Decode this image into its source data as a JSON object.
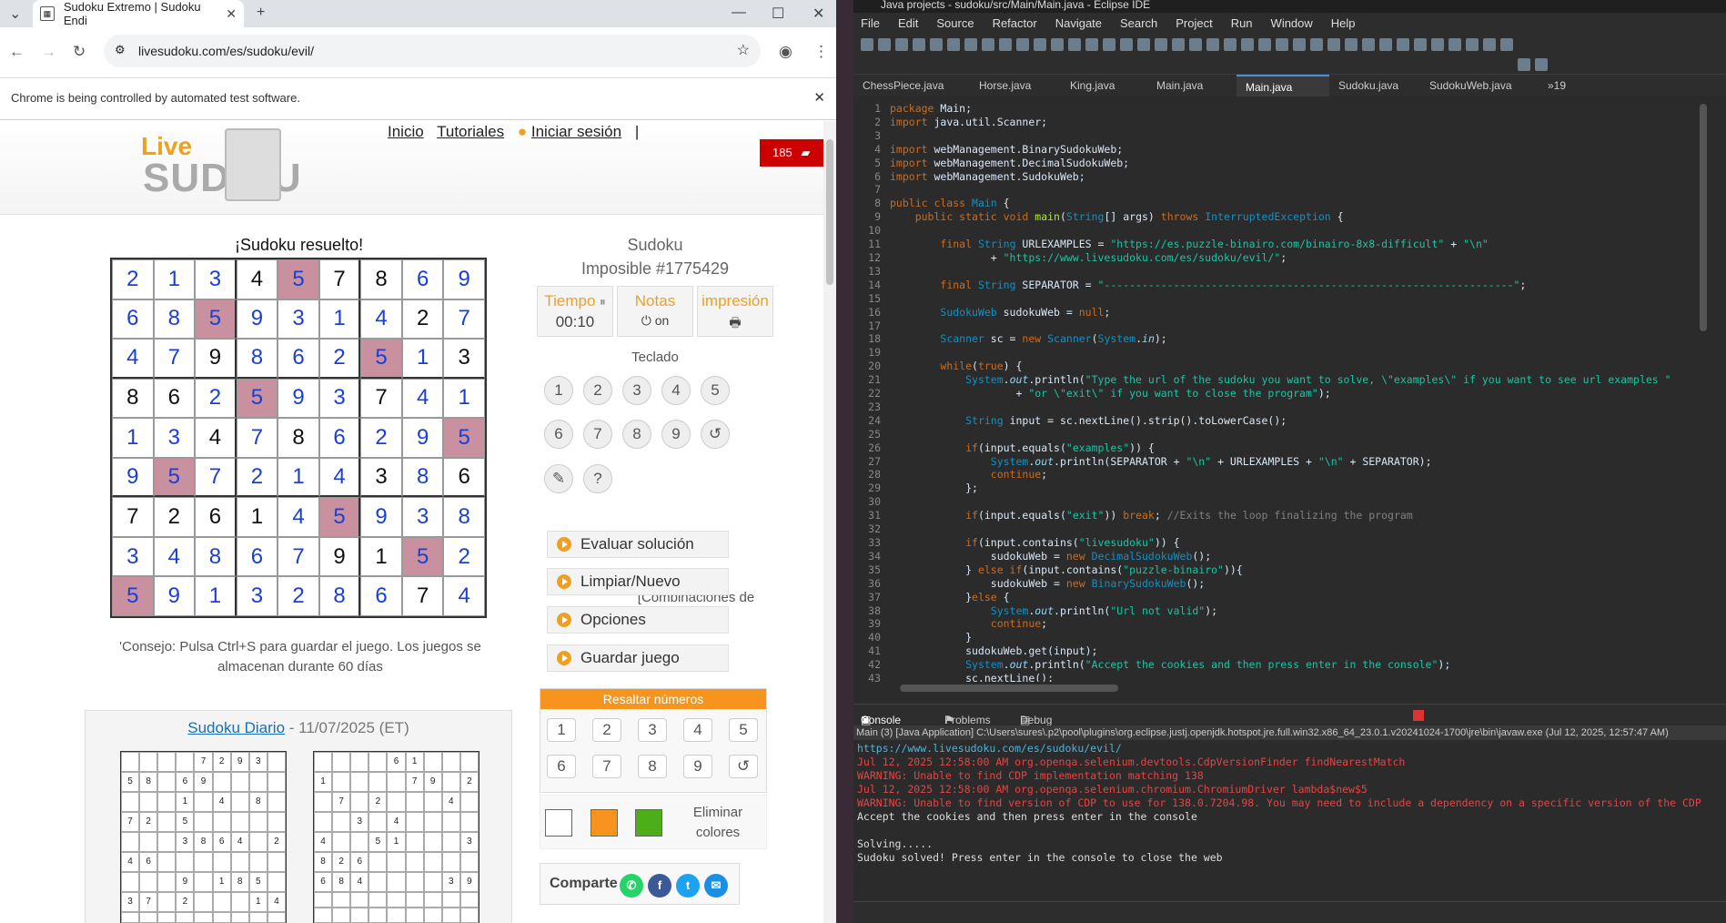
{
  "browser": {
    "tab_title": "Sudoku Extremo | Sudoku Endi",
    "url": "livesudoku.com/es/sudoku/evil/",
    "infobar": "Chrome is being controlled by automated test software."
  },
  "site": {
    "logo_top": "Live",
    "logo_bottom": "SUD  KU",
    "nav": [
      "Inicio",
      "Tutoriales",
      "Iniciar sesión"
    ],
    "message_count": "185",
    "solved_title": "¡Sudoku resuelto!",
    "puzzle_type": "Sudoku",
    "puzzle_id": "Imposible #1775429",
    "tiempo_label": "Tiempo",
    "tiempo_value": "00:10",
    "notas_label": "Notas",
    "notas_value": "on",
    "impresion_label": "impresión",
    "teclado": "Teclado",
    "keypad": [
      "1",
      "2",
      "3",
      "4",
      "5",
      "6",
      "7",
      "8",
      "9",
      "↺"
    ],
    "keypad_extra": [
      "✎",
      "?"
    ],
    "combinaciones": "[Combinaciones de teclas]",
    "actions": [
      "Evaluar solución",
      "Limpiar/Nuevo",
      "Opciones",
      "Guardar juego"
    ],
    "tip": "'Consejo: Pulsa Ctrl+S para guardar el juego. Los juegos se almacenan durante 60 días",
    "highlight_title": "Resaltar números",
    "highlight_keys": [
      "1",
      "2",
      "3",
      "4",
      "5",
      "6",
      "7",
      "8",
      "9",
      "↺"
    ],
    "swatch_colors": [
      "#ffffff",
      "#f7941d",
      "#4caf1a"
    ],
    "eliminar": "Eliminar colores",
    "share_label": "Comparte",
    "daily_link": "Sudoku Diario",
    "daily_date": " - 11/07/2025 (ET)"
  },
  "sudoku": {
    "values": [
      [
        2,
        1,
        3,
        4,
        5,
        7,
        8,
        6,
        9
      ],
      [
        6,
        8,
        5,
        9,
        3,
        1,
        4,
        2,
        7
      ],
      [
        4,
        7,
        9,
        8,
        6,
        2,
        5,
        1,
        3
      ],
      [
        8,
        6,
        2,
        5,
        9,
        3,
        7,
        4,
        1
      ],
      [
        1,
        3,
        4,
        7,
        8,
        6,
        2,
        9,
        5
      ],
      [
        9,
        5,
        7,
        2,
        1,
        4,
        3,
        8,
        6
      ],
      [
        7,
        2,
        6,
        1,
        4,
        5,
        9,
        3,
        8
      ],
      [
        3,
        4,
        8,
        6,
        7,
        9,
        1,
        5,
        2
      ],
      [
        5,
        9,
        1,
        3,
        2,
        8,
        6,
        7,
        4
      ]
    ],
    "given": [
      [
        0,
        0,
        0,
        1,
        0,
        1,
        1,
        0,
        0
      ],
      [
        0,
        0,
        0,
        0,
        0,
        0,
        0,
        1,
        0
      ],
      [
        0,
        0,
        1,
        0,
        0,
        0,
        0,
        0,
        1
      ],
      [
        1,
        1,
        0,
        0,
        0,
        0,
        1,
        0,
        0
      ],
      [
        0,
        0,
        1,
        0,
        1,
        0,
        0,
        0,
        0
      ],
      [
        0,
        0,
        0,
        0,
        0,
        0,
        1,
        0,
        1
      ],
      [
        1,
        1,
        1,
        1,
        0,
        0,
        0,
        0,
        0
      ],
      [
        0,
        0,
        0,
        0,
        0,
        1,
        1,
        0,
        0
      ],
      [
        0,
        0,
        0,
        0,
        0,
        0,
        0,
        1,
        0
      ]
    ],
    "highlighted": [
      [
        0,
        0,
        0,
        0,
        1,
        0,
        0,
        0,
        0
      ],
      [
        0,
        0,
        1,
        0,
        0,
        0,
        0,
        0,
        0
      ],
      [
        0,
        0,
        0,
        0,
        0,
        0,
        1,
        0,
        0
      ],
      [
        0,
        0,
        0,
        1,
        0,
        0,
        0,
        0,
        0
      ],
      [
        0,
        0,
        0,
        0,
        0,
        0,
        0,
        0,
        1
      ],
      [
        0,
        1,
        0,
        0,
        0,
        0,
        0,
        0,
        0
      ],
      [
        0,
        0,
        0,
        0,
        0,
        1,
        0,
        0,
        0
      ],
      [
        0,
        0,
        0,
        0,
        0,
        0,
        0,
        1,
        0
      ],
      [
        1,
        0,
        0,
        0,
        0,
        0,
        0,
        0,
        0
      ]
    ]
  },
  "mini1": [
    [
      "",
      "",
      "",
      "",
      "7",
      "2",
      "9",
      "3",
      ""
    ],
    [
      "5",
      "8",
      "",
      "6",
      "9",
      "",
      "",
      "",
      ""
    ],
    [
      "",
      "",
      "",
      "1",
      "",
      "4",
      "",
      "8",
      ""
    ],
    [
      "7",
      "2",
      "",
      "5",
      "",
      "",
      "",
      "",
      ""
    ],
    [
      "",
      "",
      "",
      "3",
      "8",
      "6",
      "4",
      "",
      "2"
    ],
    [
      "4",
      "6",
      "",
      "",
      "",
      "",
      "",
      "",
      ""
    ],
    [
      "",
      "",
      "",
      "9",
      "",
      "1",
      "8",
      "5",
      ""
    ],
    [
      "3",
      "7",
      "",
      "2",
      "",
      "",
      "",
      "1",
      "4"
    ],
    [
      "",
      "",
      "",
      "",
      "",
      "",
      "",
      "",
      ""
    ]
  ],
  "mini2": [
    [
      "",
      "",
      "",
      "",
      "6",
      "1",
      "",
      "",
      ""
    ],
    [
      "1",
      "",
      "",
      "",
      "",
      "7",
      "9",
      "",
      "2"
    ],
    [
      "",
      "7",
      "",
      "2",
      "",
      "",
      "",
      "4",
      ""
    ],
    [
      "",
      "",
      "3",
      "",
      "4",
      "",
      "",
      "",
      ""
    ],
    [
      "4",
      "",
      "",
      "5",
      "1",
      "",
      "",
      "",
      "3"
    ],
    [
      "8",
      "2",
      "6",
      "",
      "",
      "",
      "",
      "",
      ""
    ],
    [
      "6",
      "8",
      "4",
      "",
      "",
      "",
      "",
      "3",
      "9"
    ],
    [
      "",
      "",
      "",
      "",
      "",
      "",
      "",
      "",
      ""
    ],
    [
      "",
      "",
      "",
      "",
      "",
      "",
      "",
      "",
      ""
    ]
  ],
  "eclipse": {
    "title": "Java projects - sudoku/src/Main/Main.java - Eclipse IDE",
    "menu": [
      "File",
      "Edit",
      "Source",
      "Refactor",
      "Navigate",
      "Search",
      "Project",
      "Run",
      "Window",
      "Help"
    ],
    "tabs": [
      "ChessPiece.java",
      "Horse.java",
      "King.java",
      "Main.java",
      "Main.java",
      "Sudoku.java",
      "SudokuWeb.java",
      "»19"
    ],
    "console_tabs": [
      "Console",
      "Problems",
      "Debug Shell"
    ],
    "console_header": "Main (3) [Java Application] C:\\Users\\sures\\.p2\\pool\\plugins\\org.eclipse.justj.openjdk.hotspot.jre.full.win32.x86_64_23.0.1.v20241024-1700\\jre\\bin\\javaw.exe (Jul 12, 2025, 12:57:47 AM)",
    "console_lines": [
      {
        "t": "https://www.livesudoku.com/es/sudoku/evil/",
        "c": "url"
      },
      {
        "t": "Jul 12, 2025 12:58:00 AM org.openqa.selenium.devtools.CdpVersionFinder findNearestMatch",
        "c": "err"
      },
      {
        "t": "WARNING: Unable to find CDP implementation matching 138",
        "c": "err"
      },
      {
        "t": "Jul 12, 2025 12:58:00 AM org.openqa.selenium.chromium.ChromiumDriver lambda$new$5",
        "c": "err"
      },
      {
        "t": "WARNING: Unable to find version of CDP to use for 138.0.7204.98. You may need to include a dependency on a specific version of the CDP",
        "c": "err"
      },
      {
        "t": "Accept the cookies and then press enter in the console",
        "c": ""
      },
      {
        "t": "",
        "c": ""
      },
      {
        "t": "Solving.....",
        "c": ""
      },
      {
        "t": "Sudoku solved! Press enter in the console to close the web",
        "c": ""
      }
    ]
  }
}
